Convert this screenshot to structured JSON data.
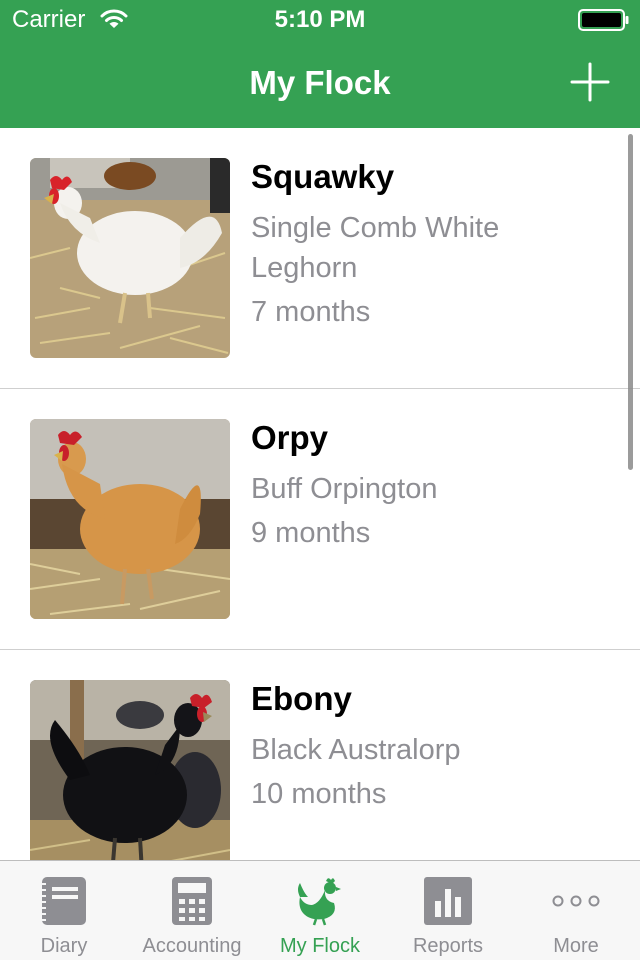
{
  "status_bar": {
    "carrier": "Carrier",
    "time": "5:10 PM"
  },
  "nav": {
    "title": "My Flock",
    "add_icon": "plus-icon"
  },
  "flock": [
    {
      "name": "Squawky",
      "breed": "Single Comb White Leghorn",
      "age": "7 months",
      "photo": "white-leghorn-hen-photo"
    },
    {
      "name": "Orpy",
      "breed": "Buff Orpington",
      "age": "9 months",
      "photo": "buff-orpington-hen-photo"
    },
    {
      "name": "Ebony",
      "breed": "Black Australorp",
      "age": "10 months",
      "photo": "black-australorp-hen-photo"
    }
  ],
  "tab_bar": {
    "tabs": [
      {
        "label": "Diary",
        "icon": "diary-notebook-icon"
      },
      {
        "label": "Accounting",
        "icon": "calculator-icon"
      },
      {
        "label": "My Flock",
        "icon": "chicken-icon",
        "active": true
      },
      {
        "label": "Reports",
        "icon": "bar-chart-icon"
      },
      {
        "label": "More",
        "icon": "more-dots-icon"
      }
    ]
  },
  "colors": {
    "brand_green": "#35a153",
    "secondary_text": "#8e8e93",
    "inactive_icon": "#8e8e93"
  }
}
